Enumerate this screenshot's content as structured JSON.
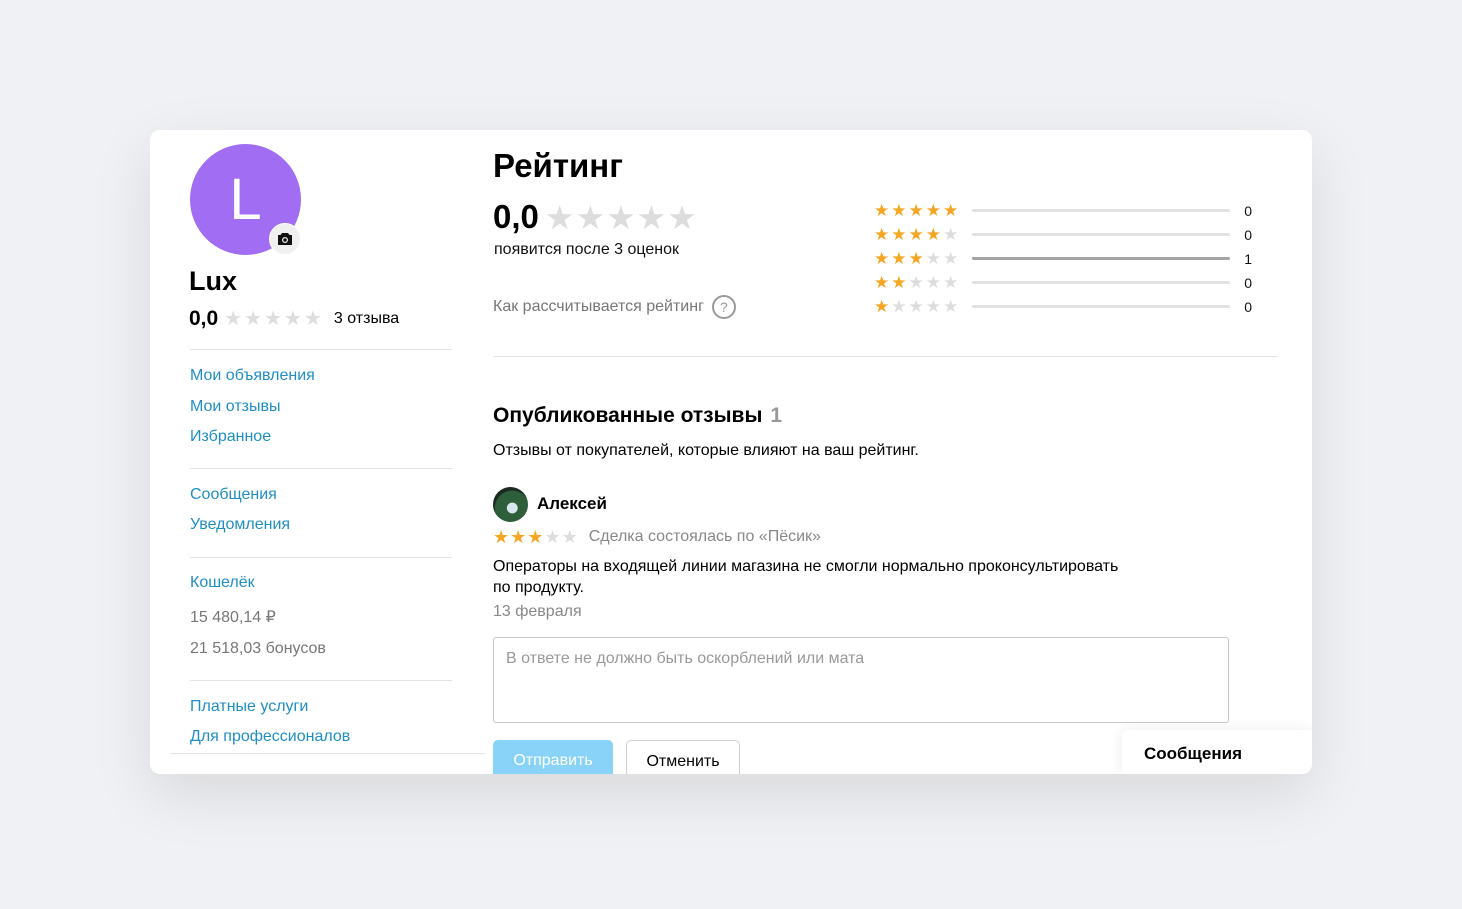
{
  "colors": {
    "accent_link": "#1f8ec5",
    "star_filled": "#f5a623",
    "star_empty": "#dddddd",
    "avatar_bg": "#a16df2",
    "send_button_bg": "#88d3f7"
  },
  "profile": {
    "avatar_letter": "L",
    "name": "Lux",
    "rating": "0,0",
    "rating_stars": 0,
    "reviews_count": "3 отзыва"
  },
  "sidebar": {
    "group1": [
      "Мои объявления",
      "Мои отзывы",
      "Избранное"
    ],
    "group2": [
      "Сообщения",
      "Уведомления"
    ],
    "wallet": {
      "label": "Кошелёк",
      "balance": "15 480,14 ₽",
      "bonuses": "21 518,03 бонусов"
    },
    "group4": [
      "Платные услуги",
      "Для профессионалов"
    ]
  },
  "rating": {
    "title": "Рейтинг",
    "value": "0,0",
    "stars": 0,
    "note": "появится после 3 оценок",
    "how_link": "Как рассчитывается рейтинг",
    "distribution": [
      {
        "stars": 5,
        "count": "0",
        "share": 0
      },
      {
        "stars": 4,
        "count": "0",
        "share": 0
      },
      {
        "stars": 3,
        "count": "1",
        "share": 1
      },
      {
        "stars": 2,
        "count": "0",
        "share": 0
      },
      {
        "stars": 1,
        "count": "0",
        "share": 0
      }
    ]
  },
  "reviews": {
    "title": "Опубликованные отзывы",
    "count": "1",
    "description": "Отзывы от покупателей, которые влияют на ваш рейтинг.",
    "items": [
      {
        "author": "Алексей",
        "stars": 3,
        "deal": "Сделка состоялась по «Пёсик»",
        "text_line1": "Операторы на входящей линии магазина не смогли нормально проконсультировать",
        "text_line2": "по продукту.",
        "date": "13 февраля"
      }
    ],
    "reply_placeholder": "В ответе не должно быть оскорблений или мата",
    "send_label": "Отправить",
    "cancel_label": "Отменить"
  },
  "chat_tab": {
    "label": "Сообщения"
  }
}
